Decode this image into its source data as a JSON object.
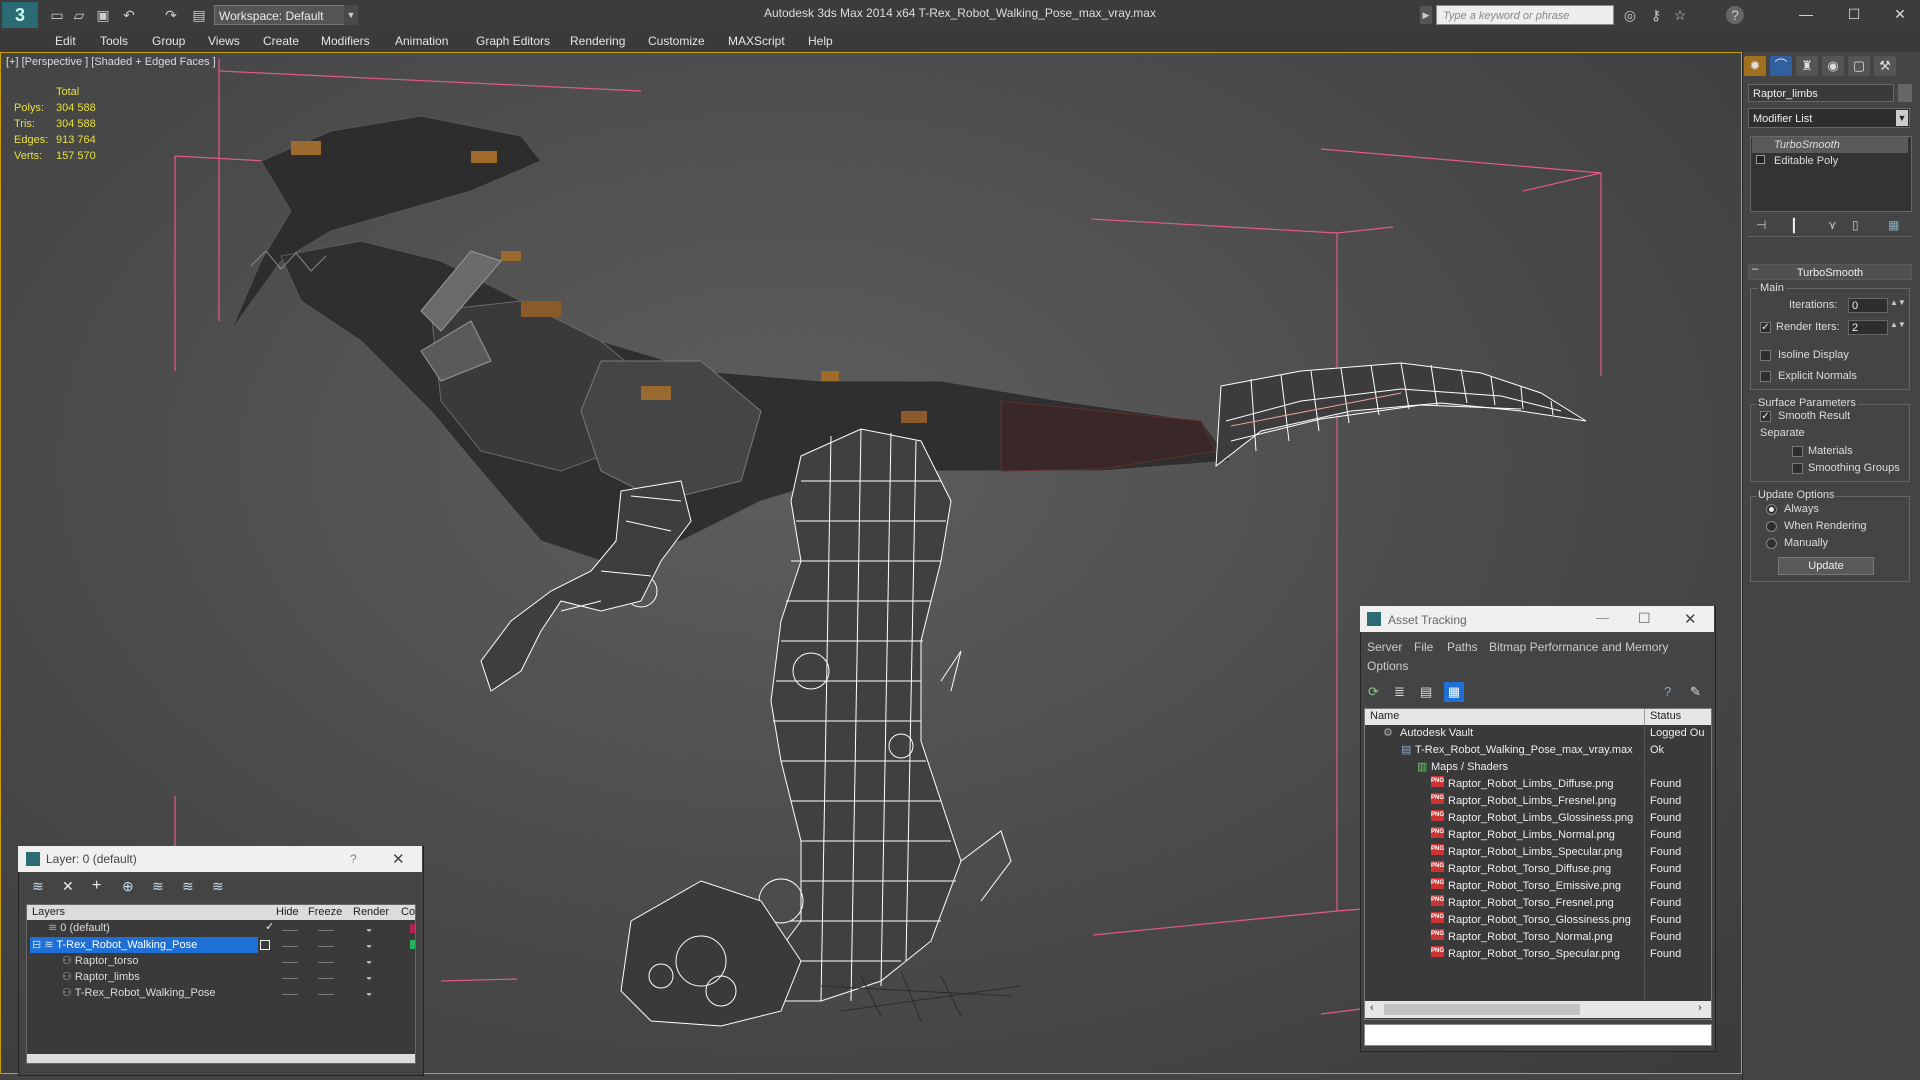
{
  "title_bar": {
    "logo": "3",
    "workspace": "Workspace: Default",
    "title": "Autodesk 3ds Max  2014 x64      T-Rex_Robot_Walking_Pose_max_vray.max",
    "search_placeholder": "Type a keyword or phrase",
    "icons": [
      "binoculars-icon",
      "key-icon",
      "star-icon",
      "help-icon"
    ]
  },
  "menus": [
    "Edit",
    "Tools",
    "Group",
    "Views",
    "Create",
    "Modifiers",
    "Animation",
    "Graph Editors",
    "Rendering",
    "Customize",
    "MAXScript",
    "Help"
  ],
  "viewport": {
    "label": "[+] [Perspective ] [Shaded + Edged Faces ]",
    "stats": {
      "header": "Total",
      "rows": [
        {
          "label": "Polys:",
          "value": "304 588"
        },
        {
          "label": "Tris:",
          "value": "304 588"
        },
        {
          "label": "Edges:",
          "value": "913 764"
        },
        {
          "label": "Verts:",
          "value": "157 570"
        }
      ]
    }
  },
  "command_panel": {
    "object_name": "Raptor_limbs",
    "modifier_list": "Modifier List",
    "stack": [
      "TurboSmooth",
      "Editable Poly"
    ],
    "rollout_title": "TurboSmooth",
    "main_group": "Main",
    "iterations_label": "Iterations:",
    "iterations_value": "0",
    "render_iters_label": "Render Iters:",
    "render_iters_value": "2",
    "isoline_label": "Isoline Display",
    "explicit_normals_label": "Explicit Normals",
    "surface_group": "Surface Parameters",
    "smooth_result_label": "Smooth Result",
    "separate_label": "Separate",
    "materials_label": "Materials",
    "smoothing_groups_label": "Smoothing Groups",
    "update_group": "Update Options",
    "always_label": "Always",
    "when_rendering_label": "When Rendering",
    "manually_label": "Manually",
    "update_button": "Update"
  },
  "layer_dialog": {
    "title": "Layer: 0 (default)",
    "help": "?",
    "columns": [
      "Layers",
      "Hide",
      "Freeze",
      "Render",
      "Co"
    ],
    "rows": [
      {
        "name": "0 (default)",
        "indent": 1,
        "selected": false
      },
      {
        "name": "T-Rex_Robot_Walking_Pose",
        "indent": 1,
        "selected": true
      },
      {
        "name": "Raptor_torso",
        "indent": 2,
        "selected": false
      },
      {
        "name": "Raptor_limbs",
        "indent": 2,
        "selected": false
      },
      {
        "name": "T-Rex_Robot_Walking_Pose",
        "indent": 2,
        "selected": false
      }
    ]
  },
  "asset_dialog": {
    "title": "Asset Tracking",
    "menus": [
      "Server",
      "File",
      "Paths",
      "Bitmap Performance and Memory",
      "Options"
    ],
    "columns": [
      "Name",
      "Status"
    ],
    "rows": [
      {
        "name": "Autodesk Vault",
        "status": "Logged Ou",
        "indent": 1,
        "type": "vault"
      },
      {
        "name": "T-Rex_Robot_Walking_Pose_max_vray.max",
        "status": "Ok",
        "indent": 2,
        "type": "max"
      },
      {
        "name": "Maps / Shaders",
        "status": "",
        "indent": 3,
        "type": "folder"
      },
      {
        "name": "Raptor_Robot_Limbs_Diffuse.png",
        "status": "Found",
        "indent": 4,
        "type": "png"
      },
      {
        "name": "Raptor_Robot_Limbs_Fresnel.png",
        "status": "Found",
        "indent": 4,
        "type": "png"
      },
      {
        "name": "Raptor_Robot_Limbs_Glossiness.png",
        "status": "Found",
        "indent": 4,
        "type": "png"
      },
      {
        "name": "Raptor_Robot_Limbs_Normal.png",
        "status": "Found",
        "indent": 4,
        "type": "png"
      },
      {
        "name": "Raptor_Robot_Limbs_Specular.png",
        "status": "Found",
        "indent": 4,
        "type": "png"
      },
      {
        "name": "Raptor_Robot_Torso_Diffuse.png",
        "status": "Found",
        "indent": 4,
        "type": "png"
      },
      {
        "name": "Raptor_Robot_Torso_Emissive.png",
        "status": "Found",
        "indent": 4,
        "type": "png"
      },
      {
        "name": "Raptor_Robot_Torso_Fresnel.png",
        "status": "Found",
        "indent": 4,
        "type": "png"
      },
      {
        "name": "Raptor_Robot_Torso_Glossiness.png",
        "status": "Found",
        "indent": 4,
        "type": "png"
      },
      {
        "name": "Raptor_Robot_Torso_Normal.png",
        "status": "Found",
        "indent": 4,
        "type": "png"
      },
      {
        "name": "Raptor_Robot_Torso_Specular.png",
        "status": "Found",
        "indent": 4,
        "type": "png"
      }
    ]
  },
  "colors": {
    "accent_yellow": "#c8a000",
    "stats_yellow": "#e8e040",
    "selection_blue": "#1e6fd6",
    "bbox_pink": "#e05a8a"
  }
}
